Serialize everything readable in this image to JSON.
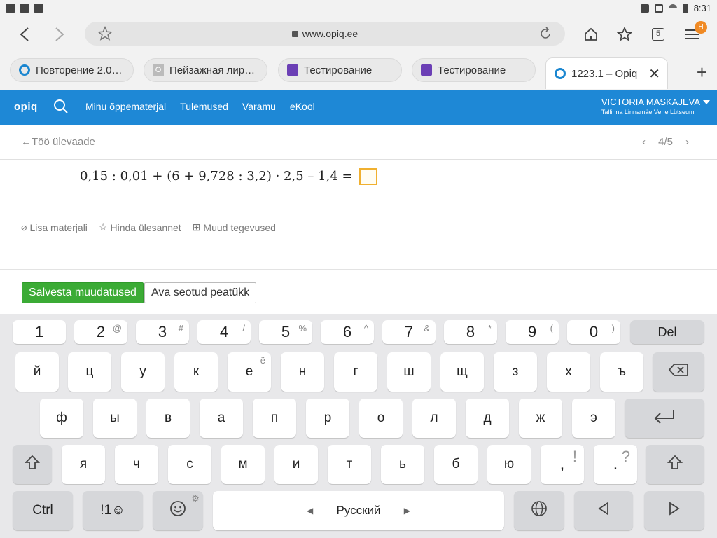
{
  "status_bar": {
    "time": "8:31"
  },
  "browser": {
    "url": "www.opiq.ee",
    "tab_count": "5",
    "menu_badge": "H",
    "tabs": [
      {
        "label": "Повторение 2.0…",
        "favicon": "opiq-icon"
      },
      {
        "label": "Пейзажная лир…",
        "favicon": "generic-o-icon",
        "favicon_letter": "O"
      },
      {
        "label": "Тестирование",
        "favicon": "form-icon"
      },
      {
        "label": "Тестирование",
        "favicon": "form-icon"
      },
      {
        "label": "1223.1 – Opiq",
        "favicon": "opiq-icon",
        "active": true
      }
    ]
  },
  "site_nav": {
    "logo": "opiq",
    "links": [
      "Minu õppematerjal",
      "Tulemused",
      "Varamu",
      "eKool"
    ],
    "user_name": "VICTORIA MASKAJEVA",
    "user_school": "Tallinna Linnamäe Vene Lütseum"
  },
  "subheader": {
    "back_label": "Töö ülevaade",
    "page_indicator": "4/5"
  },
  "exercise": {
    "equation": "0,15 : 0,01 + (6 + 9,728 : 3,2) · 2,5 – 1,4 ="
  },
  "actions": {
    "add_material": "Lisa materjali",
    "rate_tasks": "Hinda ülesannet",
    "other_actions": "Muud tegevused"
  },
  "buttons": {
    "save": "Salvesta muudatused",
    "open_chapter": "Ava seotud peatükk"
  },
  "keyboard": {
    "numbers": [
      {
        "main": "1",
        "sub": "–"
      },
      {
        "main": "2",
        "sub": "@"
      },
      {
        "main": "3",
        "sub": "#"
      },
      {
        "main": "4",
        "sub": "/"
      },
      {
        "main": "5",
        "sub": "%"
      },
      {
        "main": "6",
        "sub": "^"
      },
      {
        "main": "7",
        "sub": "&"
      },
      {
        "main": "8",
        "sub": "*"
      },
      {
        "main": "9",
        "sub": "("
      },
      {
        "main": "0",
        "sub": ")"
      }
    ],
    "del": "Del",
    "row1": [
      "й",
      "ц",
      "у",
      "к",
      "е",
      "н",
      "г",
      "ш",
      "щ",
      "з",
      "х",
      "ъ"
    ],
    "row1_sub_e": "ё",
    "row2": [
      "ф",
      "ы",
      "в",
      "а",
      "п",
      "р",
      "о",
      "л",
      "д",
      "ж",
      "э"
    ],
    "row3": [
      "я",
      "ч",
      "с",
      "м",
      "и",
      "т",
      "ь",
      "б",
      "ю"
    ],
    "comma": ",",
    "comma_sub": "!",
    "period": ".",
    "period_sub": "?",
    "ctrl": "Ctrl",
    "symbols": "!1☺",
    "language": "Русский"
  }
}
